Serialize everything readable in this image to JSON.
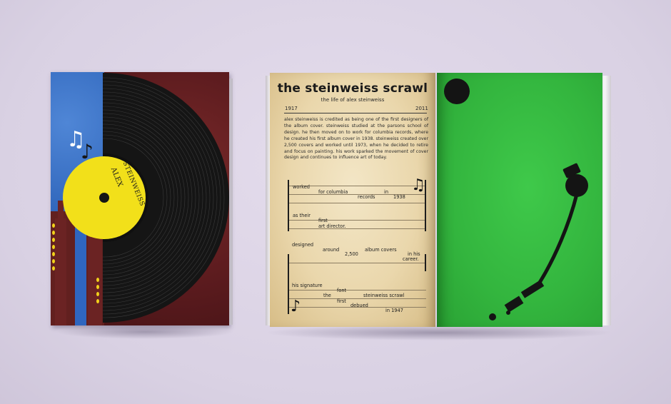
{
  "cover": {
    "label_line1": "ALEX",
    "label_line2": "STEINWEISS",
    "note_glyph": "♫",
    "note_glyph2": "♪"
  },
  "page_left": {
    "title": "the steinweiss scrawl",
    "subtitle": "the life of alex steinweiss",
    "year_start": "1917",
    "year_end": "2011",
    "body": "alex steinweiss is credited as being one of the first designers of the album cover. steinweiss studied at the parsons school of design. he then moved on to work for columbia records, where he created his first album cover in 1938. steinweiss created over 2,500 covers and worked until 1973, when he decided to retire and focus on painting. his work sparked the movement of cover design and continues to influence art of today.",
    "staff1": {
      "words": [
        "worked",
        "for columbia",
        "records",
        "in",
        "1938",
        "as their",
        "first",
        "art director."
      ]
    },
    "staff2": {
      "words": [
        "designed",
        "around",
        "2,500",
        "album covers",
        "in his",
        "career.",
        "his signature",
        "font",
        "the",
        "first",
        "steinweiss scrawl",
        "debued",
        "in 1947"
      ]
    },
    "note_glyph_top": "♫",
    "note_glyph_bottom": "♪"
  },
  "colors": {
    "green_page": "#36b840",
    "vinyl": "#141414",
    "label_yellow": "#f2e01a",
    "cover_blue": "#2c62b8",
    "cover_red": "#5e1c1f"
  }
}
